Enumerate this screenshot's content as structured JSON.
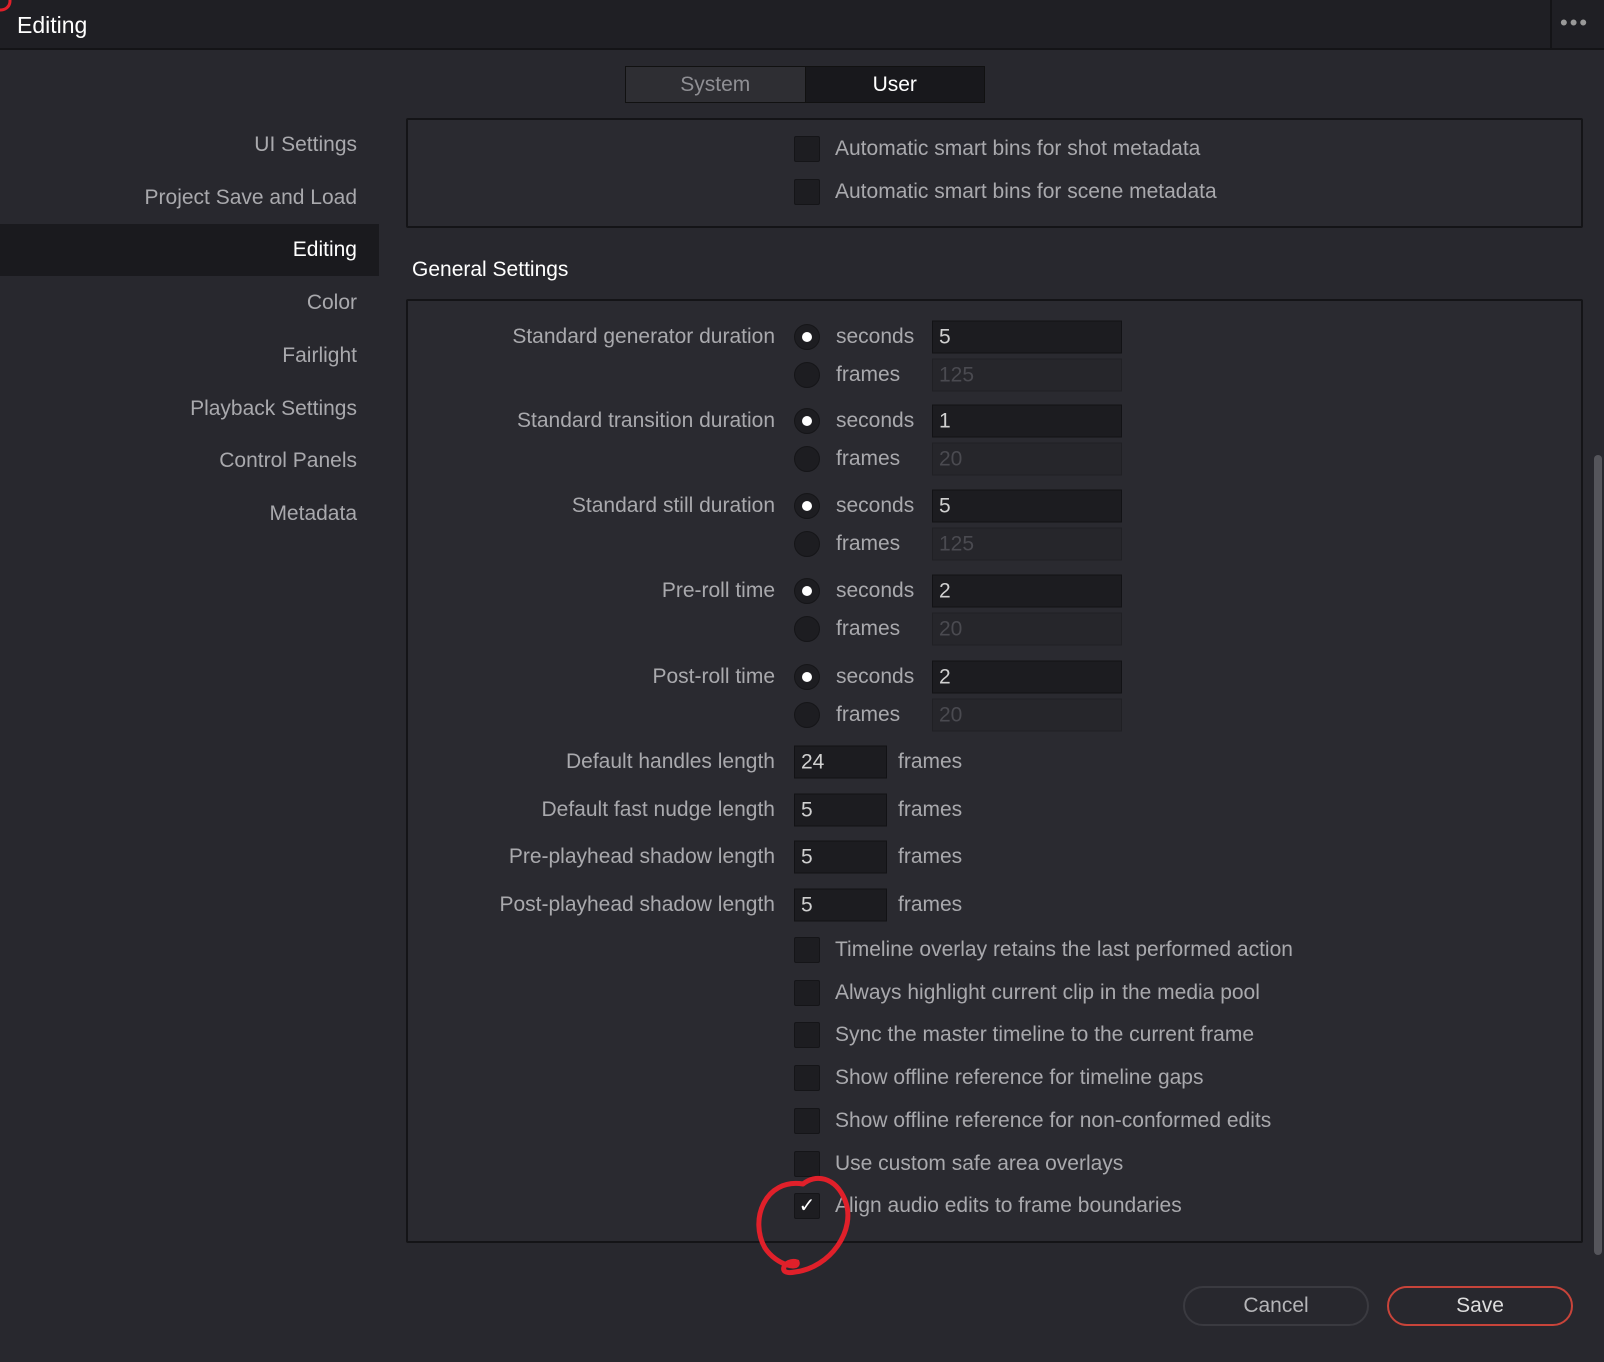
{
  "window": {
    "title": "Editing",
    "more_icon": "ellipsis-icon"
  },
  "tabs": [
    {
      "label": "System",
      "active": false
    },
    {
      "label": "User",
      "active": true
    }
  ],
  "sidebar": {
    "items": [
      "UI Settings",
      "Project Save and Load",
      "Editing",
      "Color",
      "Fairlight",
      "Playback Settings",
      "Control Panels",
      "Metadata"
    ],
    "selected": "Editing"
  },
  "top_section": {
    "checkboxes": [
      {
        "label": "Automatic smart bins for shot metadata",
        "checked": false
      },
      {
        "label": "Automatic smart bins for scene metadata",
        "checked": false
      }
    ]
  },
  "general": {
    "title": "General Settings",
    "durations": [
      {
        "label": "Standard generator duration",
        "mode": "seconds",
        "seconds": "5",
        "frames": "125"
      },
      {
        "label": "Standard transition duration",
        "mode": "seconds",
        "seconds": "1",
        "frames": "20"
      },
      {
        "label": "Standard still duration",
        "mode": "seconds",
        "seconds": "5",
        "frames": "125"
      },
      {
        "label": "Pre-roll time",
        "mode": "seconds",
        "seconds": "2",
        "frames": "20"
      },
      {
        "label": "Post-roll time",
        "mode": "seconds",
        "seconds": "2",
        "frames": "20"
      }
    ],
    "seconds_label": "seconds",
    "frames_label": "frames",
    "lengths": [
      {
        "label": "Default handles length",
        "value": "24",
        "unit": "frames"
      },
      {
        "label": "Default fast nudge length",
        "value": "5",
        "unit": "frames"
      },
      {
        "label": "Pre-playhead shadow length",
        "value": "5",
        "unit": "frames"
      },
      {
        "label": "Post-playhead shadow length",
        "value": "5",
        "unit": "frames"
      }
    ],
    "checkboxes": [
      {
        "label": "Timeline overlay retains the last performed action",
        "checked": false
      },
      {
        "label": "Always highlight current clip in the media pool",
        "checked": false
      },
      {
        "label": "Sync the master timeline to the current frame",
        "checked": false
      },
      {
        "label": "Show offline reference for timeline gaps",
        "checked": false
      },
      {
        "label": "Show offline reference for non-conformed edits",
        "checked": false
      },
      {
        "label": "Use custom safe area overlays",
        "checked": false
      },
      {
        "label": "Align audio edits to frame boundaries",
        "checked": true
      }
    ]
  },
  "buttons": {
    "cancel": "Cancel",
    "save": "Save"
  },
  "colors": {
    "annotation": "#e0202a",
    "save_border": "#c8443a",
    "background": "#28282e"
  }
}
